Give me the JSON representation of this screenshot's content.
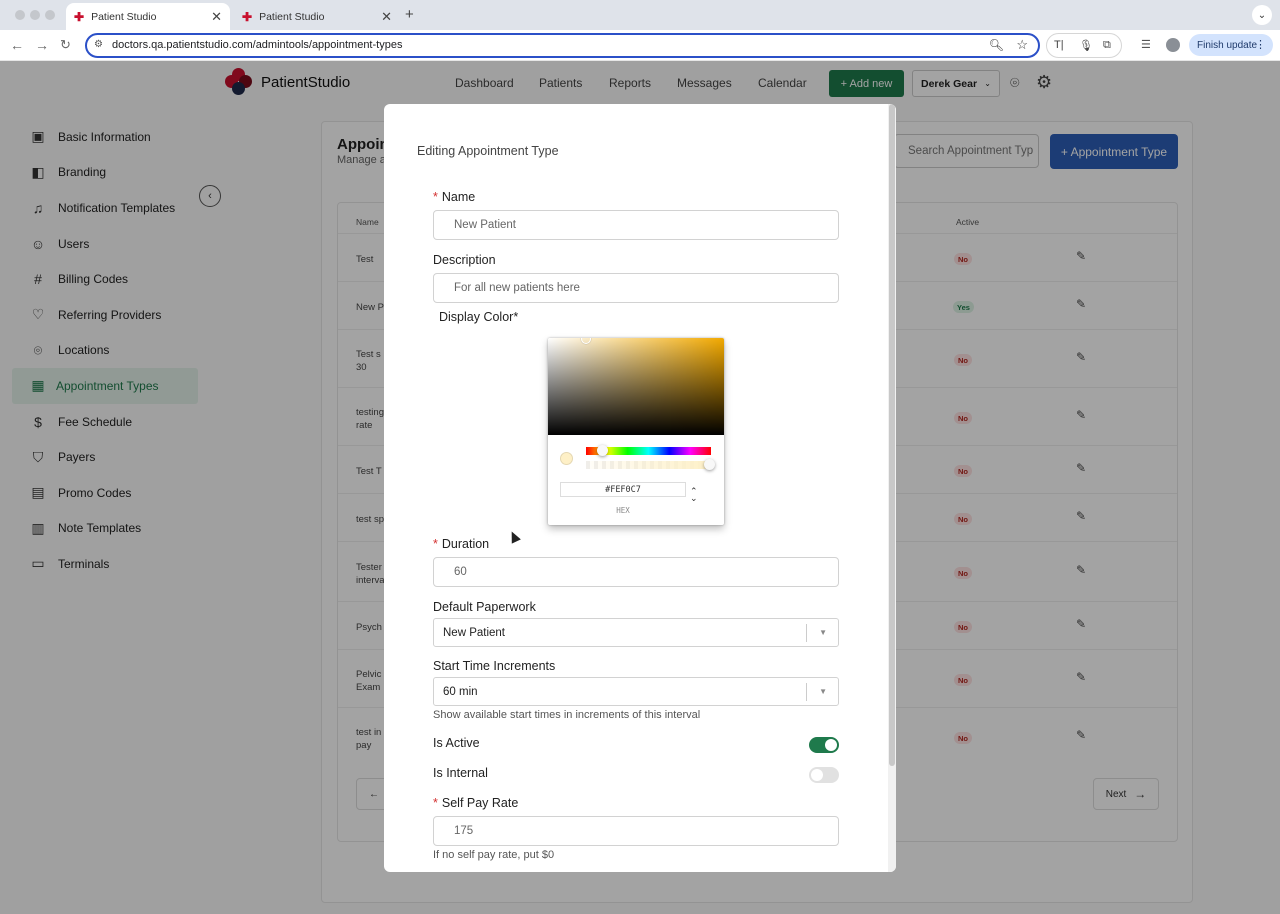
{
  "browser": {
    "tabs": [
      {
        "title": "Patient Studio",
        "active": true
      },
      {
        "title": "Patient Studio",
        "active": false
      }
    ],
    "url": "doctors.qa.patientstudio.com/admintools/appointment-types",
    "finish_update": "Finish update"
  },
  "header": {
    "brand": "PatientStudio",
    "nav": [
      "Dashboard",
      "Patients",
      "Reports",
      "Messages",
      "Calendar"
    ],
    "add_new": "+ Add new",
    "user": "Derek Gear"
  },
  "sidebar": {
    "items": [
      {
        "label": "Basic Information",
        "icon": "id-card-icon"
      },
      {
        "label": "Branding",
        "icon": "palette-icon"
      },
      {
        "label": "Notification Templates",
        "icon": "bell-icon"
      },
      {
        "label": "Users",
        "icon": "users-icon"
      },
      {
        "label": "Billing Codes",
        "icon": "hash-icon"
      },
      {
        "label": "Referring Providers",
        "icon": "heart-icon"
      },
      {
        "label": "Locations",
        "icon": "map-pin-icon"
      },
      {
        "label": "Appointment Types",
        "icon": "calendar-icon",
        "active": true
      },
      {
        "label": "Fee Schedule",
        "icon": "dollar-icon"
      },
      {
        "label": "Payers",
        "icon": "shield-icon"
      },
      {
        "label": "Promo Codes",
        "icon": "coupon-icon"
      },
      {
        "label": "Note Templates",
        "icon": "layout-icon"
      },
      {
        "label": "Terminals",
        "icon": "card-terminal-icon"
      }
    ]
  },
  "main": {
    "title": "Appoin",
    "subtitle": "Manage a",
    "search_placeholder": "Search Appointment Typ",
    "add_button": "+ Appointment Type",
    "table": {
      "headers": [
        "Name",
        "Active"
      ],
      "rows": [
        {
          "name": "Test",
          "active": "No"
        },
        {
          "name": "New P",
          "active": "Yes"
        },
        {
          "name": "Test s\n30",
          "active": "No"
        },
        {
          "name": "testing\nrate",
          "active": "No"
        },
        {
          "name": "Test T",
          "active": "No"
        },
        {
          "name": "test sp",
          "active": "No"
        },
        {
          "name": "Tester\ninterva",
          "active": "No"
        },
        {
          "name": "Psych",
          "active": "No"
        },
        {
          "name": "Pelvic\nExam",
          "active": "No"
        },
        {
          "name": "test in\npay",
          "active": "No"
        }
      ]
    },
    "pagination": {
      "next": "Next"
    }
  },
  "modal": {
    "title": "Editing Appointment Type",
    "name_label": "Name",
    "name_value": "New Patient",
    "description_label": "Description",
    "description_value": "For all new patients here",
    "display_color_label": "Display Color*",
    "color_picker": {
      "hex": "#FEF0C7",
      "mode_label": "HEX",
      "color": "#fef0c7"
    },
    "duration_label": "Duration",
    "duration_value": "60",
    "paperwork_label": "Default Paperwork",
    "paperwork_value": "New Patient",
    "increments_label": "Start Time Increments",
    "increments_value": "60 min",
    "increments_help": "Show available start times in increments of this interval",
    "is_active_label": "Is Active",
    "is_active": true,
    "is_internal_label": "Is Internal",
    "is_internal": false,
    "self_pay_label": "Self Pay Rate",
    "self_pay_value": "175",
    "self_pay_help": "If no self pay rate, put $0"
  }
}
